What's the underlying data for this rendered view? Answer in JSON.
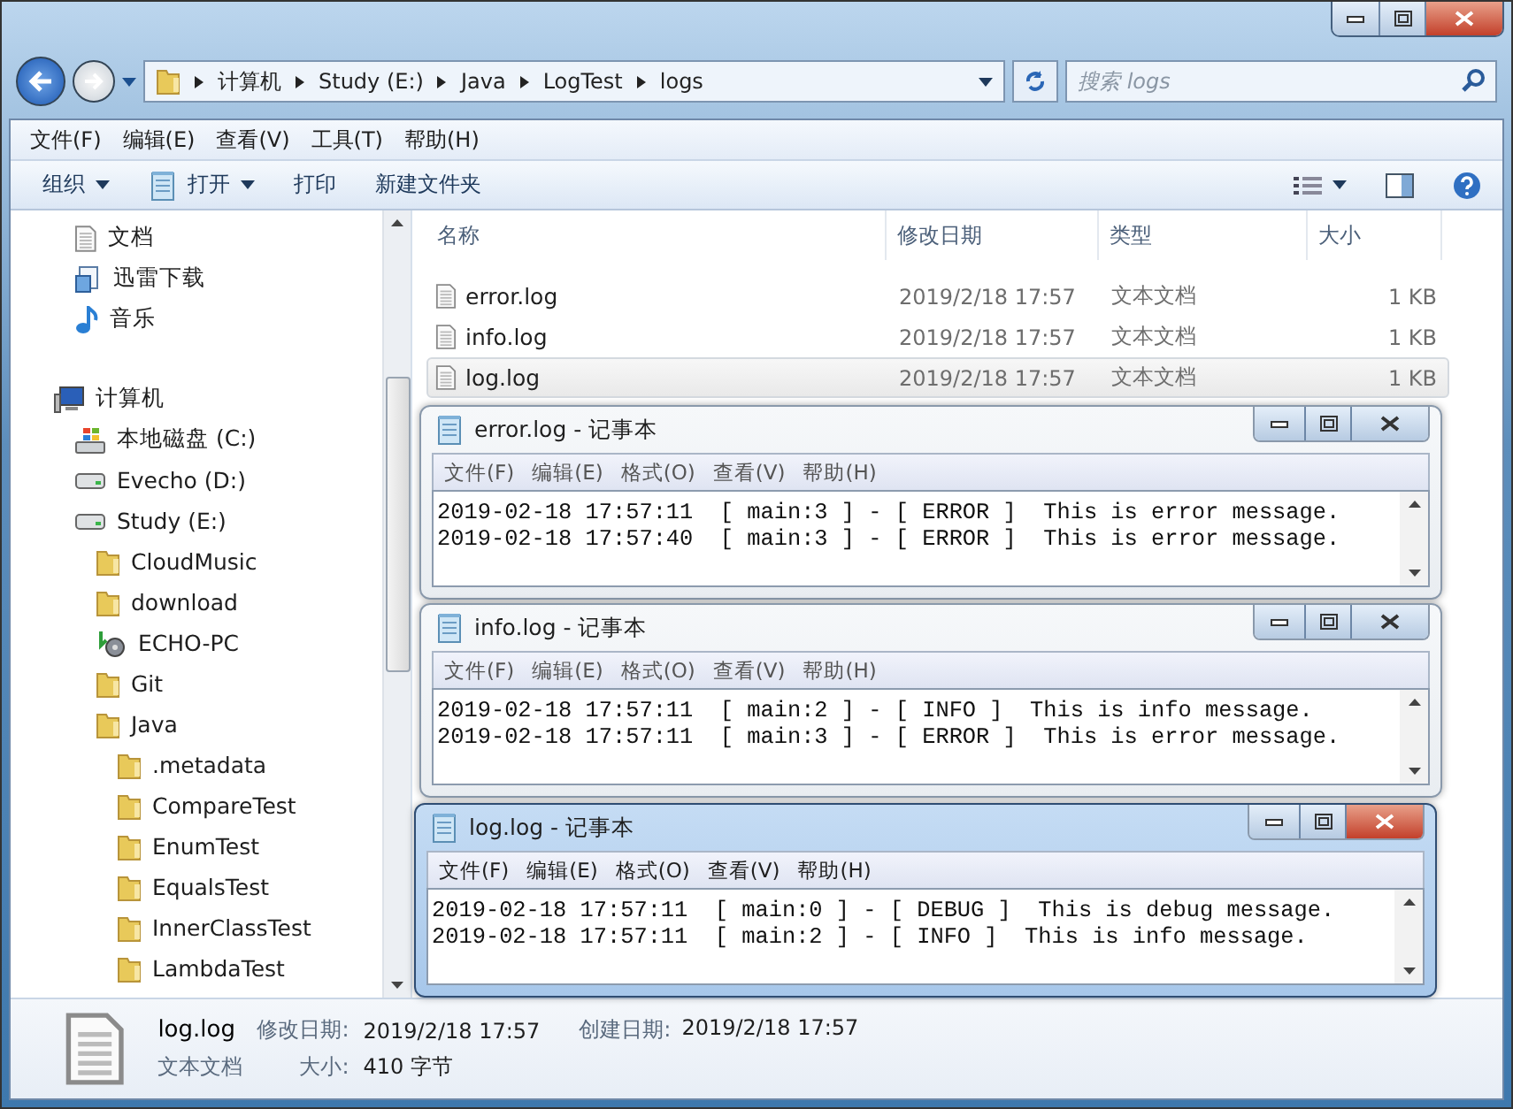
{
  "address": {
    "crumbs": [
      "计算机",
      "Study (E:)",
      "Java",
      "LogTest",
      "logs"
    ],
    "search_placeholder": "搜索 logs"
  },
  "menu": [
    "文件(F)",
    "编辑(E)",
    "查看(V)",
    "工具(T)",
    "帮助(H)"
  ],
  "toolbar": [
    {
      "label": "组织",
      "dropdown": true,
      "icon": false
    },
    {
      "label": "打开",
      "dropdown": true,
      "icon": true
    },
    {
      "label": "打印",
      "dropdown": false,
      "icon": false
    },
    {
      "label": "新建文件夹",
      "dropdown": false,
      "icon": false
    }
  ],
  "sidebar": {
    "items": [
      {
        "label": "文档",
        "kind": "doc"
      },
      {
        "label": "迅雷下载",
        "kind": "download"
      },
      {
        "label": "音乐",
        "kind": "music"
      },
      {
        "label": "计算机",
        "kind": "computer",
        "children": [
          {
            "label": "本地磁盘 (C:)",
            "kind": "system-drive"
          },
          {
            "label": "Evecho (D:)",
            "kind": "drive"
          },
          {
            "label": "Study (E:)",
            "kind": "drive",
            "children": [
              {
                "label": "CloudMusic",
                "kind": "folder"
              },
              {
                "label": "download",
                "kind": "folder"
              },
              {
                "label": "ECHO-PC",
                "kind": "network"
              },
              {
                "label": "Git",
                "kind": "folder"
              },
              {
                "label": "Java",
                "kind": "folder",
                "children": [
                  {
                    "label": ".metadata",
                    "kind": "folder"
                  },
                  {
                    "label": "CompareTest",
                    "kind": "folder"
                  },
                  {
                    "label": "EnumTest",
                    "kind": "folder"
                  },
                  {
                    "label": "EqualsTest",
                    "kind": "folder"
                  },
                  {
                    "label": "InnerClassTest",
                    "kind": "folder"
                  },
                  {
                    "label": "LambdaTest",
                    "kind": "folder"
                  }
                ]
              }
            ]
          }
        ]
      }
    ]
  },
  "table": {
    "columns": [
      "名称",
      "修改日期",
      "类型",
      "大小"
    ],
    "rows": [
      {
        "name": "error.log",
        "date": "2019/2/18 17:57",
        "type": "文本文档",
        "size": "1 KB",
        "selected": false
      },
      {
        "name": "info.log",
        "date": "2019/2/18 17:57",
        "type": "文本文档",
        "size": "1 KB",
        "selected": false
      },
      {
        "name": "log.log",
        "date": "2019/2/18 17:57",
        "type": "文本文档",
        "size": "1 KB",
        "selected": true
      }
    ]
  },
  "notepads": [
    {
      "title": "error.log - 记事本",
      "active": false,
      "menu": [
        "文件(F)",
        "编辑(E)",
        "格式(O)",
        "查看(V)",
        "帮助(H)"
      ],
      "lines": [
        "2019-02-18 17:57:11  [ main:3 ] - [ ERROR ]  This is error message.",
        "2019-02-18 17:57:40  [ main:3 ] - [ ERROR ]  This is error message."
      ]
    },
    {
      "title": "info.log - 记事本",
      "active": false,
      "menu": [
        "文件(F)",
        "编辑(E)",
        "格式(O)",
        "查看(V)",
        "帮助(H)"
      ],
      "lines": [
        "2019-02-18 17:57:11  [ main:2 ] - [ INFO ]  This is info message.",
        "2019-02-18 17:57:11  [ main:3 ] - [ ERROR ]  This is error message."
      ]
    },
    {
      "title": "log.log - 记事本",
      "active": true,
      "menu": [
        "文件(F)",
        "编辑(E)",
        "格式(O)",
        "查看(V)",
        "帮助(H)"
      ],
      "lines": [
        "2019-02-18 17:57:11  [ main:0 ] - [ DEBUG ]  This is debug message.",
        "2019-02-18 17:57:11  [ main:2 ] - [ INFO ]  This is info message."
      ]
    }
  ],
  "details": {
    "name": "log.log",
    "type": "文本文档",
    "modified_label": "修改日期:",
    "modified": "2019/2/18 17:57",
    "size_label": "大小:",
    "size": "410 字节",
    "created_label": "创建日期:",
    "created": "2019/2/18 17:57"
  }
}
